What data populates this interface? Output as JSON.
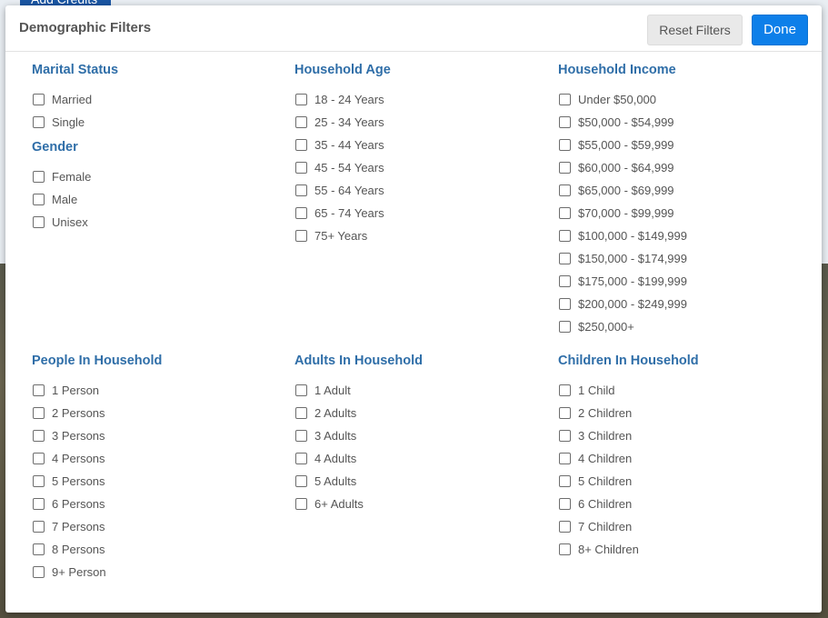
{
  "background": {
    "top_button_label": "Add Credits"
  },
  "modal": {
    "title": "Demographic Filters",
    "reset_label": "Reset Filters",
    "done_label": "Done"
  },
  "groups": {
    "marital_status": {
      "title": "Marital Status",
      "options": [
        "Married",
        "Single"
      ]
    },
    "gender": {
      "title": "Gender",
      "options": [
        "Female",
        "Male",
        "Unisex"
      ]
    },
    "household_age": {
      "title": "Household Age",
      "options": [
        "18 - 24 Years",
        "25 - 34 Years",
        "35 - 44 Years",
        "45 - 54 Years",
        "55 - 64 Years",
        "65 - 74 Years",
        "75+ Years"
      ]
    },
    "household_income": {
      "title": "Household Income",
      "options": [
        "Under $50,000",
        "$50,000 - $54,999",
        "$55,000 - $59,999",
        "$60,000 - $64,999",
        "$65,000 - $69,999",
        "$70,000 - $99,999",
        "$100,000 - $149,999",
        "$150,000 - $174,999",
        "$175,000 - $199,999",
        "$200,000 - $249,999",
        "$250,000+"
      ]
    },
    "people_in_household": {
      "title": "People In Household",
      "options": [
        "1 Person",
        "2 Persons",
        "3 Persons",
        "4 Persons",
        "5 Persons",
        "6 Persons",
        "7 Persons",
        "8 Persons",
        "9+ Person"
      ]
    },
    "adults_in_household": {
      "title": "Adults In Household",
      "options": [
        "1 Adult",
        "2 Adults",
        "3 Adults",
        "4 Adults",
        "5 Adults",
        "6+ Adults"
      ]
    },
    "children_in_household": {
      "title": "Children In Household",
      "options": [
        "1 Child",
        "2 Children",
        "3 Children",
        "4 Children",
        "5 Children",
        "6 Children",
        "7 Children",
        "8+ Children"
      ]
    }
  },
  "colors": {
    "accent": "#0d7fe9",
    "heading": "#2f6ea8",
    "text": "#555555"
  }
}
